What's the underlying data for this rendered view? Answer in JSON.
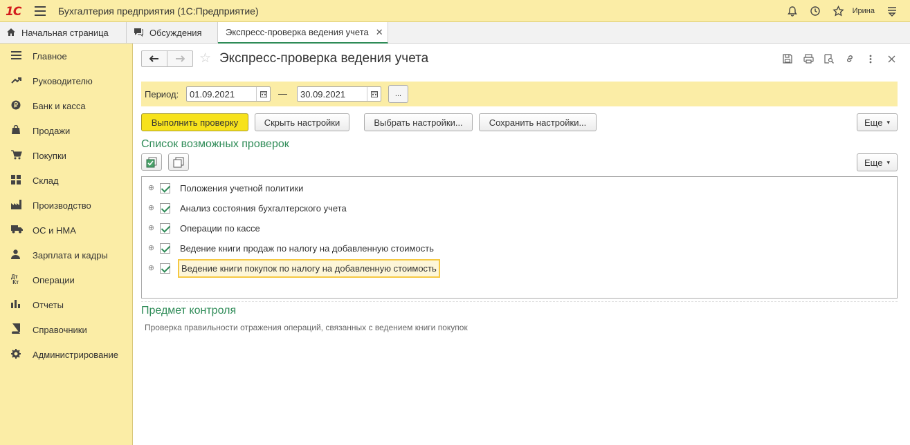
{
  "app": {
    "logo": "1С",
    "title": "Бухгалтерия предприятия  (1С:Предприятие)",
    "user": "Ирина"
  },
  "tabs": [
    {
      "label": "Начальная страница",
      "icon": "home-icon"
    },
    {
      "label": "Обсуждения",
      "icon": "chat-icon"
    },
    {
      "label": "Экспресс-проверка ведения учета",
      "icon": "",
      "active": true
    }
  ],
  "sidebar": {
    "items": [
      {
        "label": "Главное",
        "icon": "menu-lines-icon"
      },
      {
        "label": "Руководителю",
        "icon": "trend-icon"
      },
      {
        "label": "Банк и касса",
        "icon": "ruble-icon"
      },
      {
        "label": "Продажи",
        "icon": "bag-icon"
      },
      {
        "label": "Покупки",
        "icon": "cart-icon"
      },
      {
        "label": "Склад",
        "icon": "grid-icon"
      },
      {
        "label": "Производство",
        "icon": "factory-icon"
      },
      {
        "label": "ОС и НМА",
        "icon": "truck-icon"
      },
      {
        "label": "Зарплата и кадры",
        "icon": "person-icon"
      },
      {
        "label": "Операции",
        "icon": "dt-kt-icon"
      },
      {
        "label": "Отчеты",
        "icon": "bar-chart-icon"
      },
      {
        "label": "Справочники",
        "icon": "book-icon"
      },
      {
        "label": "Администрирование",
        "icon": "gear-icon"
      }
    ]
  },
  "form": {
    "title": "Экспресс-проверка ведения учета",
    "period_label": "Период:",
    "date_from": "01.09.2021",
    "date_to": "30.09.2021",
    "dash": "—",
    "dots": "...",
    "buttons": {
      "run": "Выполнить проверку",
      "hide": "Скрыть настройки",
      "choose": "Выбрать настройки...",
      "save": "Сохранить настройки...",
      "more": "Еще",
      "more2": "Еще"
    },
    "checks_title": "Список возможных проверок",
    "checks": [
      {
        "label": "Положения учетной политики",
        "checked": true
      },
      {
        "label": "Анализ состояния бухгалтерского учета",
        "checked": true
      },
      {
        "label": "Операции по кассе",
        "checked": true
      },
      {
        "label": "Ведение книги продаж по налогу на добавленную стоимость",
        "checked": true
      },
      {
        "label": "Ведение книги покупок по налогу на добавленную стоимость",
        "checked": true,
        "selected": true
      }
    ],
    "control_title": "Предмет контроля",
    "control_text": "Проверка правильности отражения операций, связанных с ведением книги покупок"
  },
  "colors": {
    "accent_yellow": "#fbeda6",
    "button_yellow": "#f7e21c",
    "green": "#2e8b57"
  }
}
